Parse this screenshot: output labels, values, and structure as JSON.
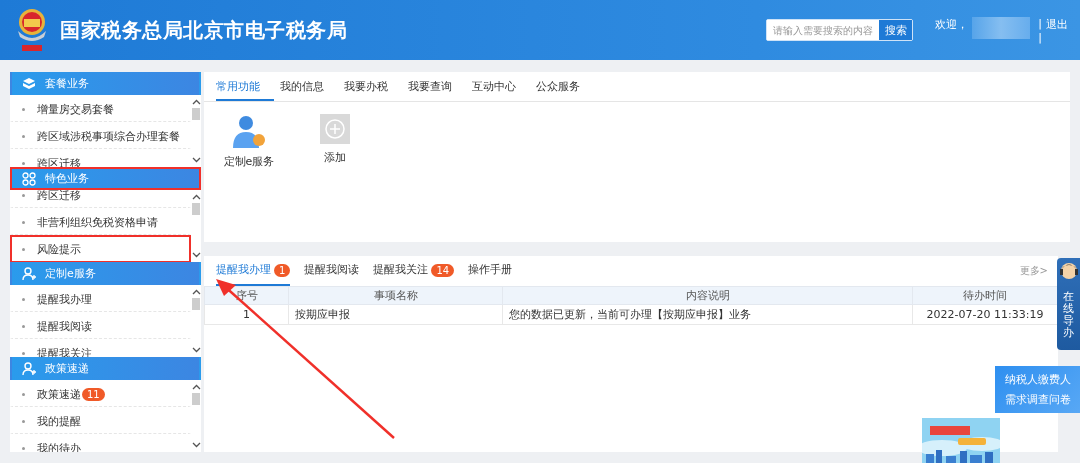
{
  "header": {
    "title": "国家税务总局北京市电子税务局",
    "search": {
      "placeholder": "请输入需要搜索的内容",
      "button": "搜索"
    },
    "welcome": "欢迎，",
    "separator": "|",
    "logout": "退出",
    "separator_2": "|"
  },
  "sidebar": {
    "sections": [
      {
        "title": "套餐业务",
        "highlighted": false,
        "items": [
          {
            "label": "增量房交易套餐",
            "highlighted": false
          },
          {
            "label": "跨区域涉税事项综合办理套餐",
            "highlighted": false
          },
          {
            "label": "跨区迁移",
            "highlighted": false
          }
        ]
      },
      {
        "title": "特色业务",
        "highlighted": true,
        "items": [
          {
            "label": "跨区迁移",
            "highlighted": false
          },
          {
            "label": "非营利组织免税资格申请",
            "highlighted": false
          },
          {
            "label": "风险提示",
            "highlighted": true
          }
        ]
      },
      {
        "title": "定制e服务",
        "highlighted": false,
        "items": [
          {
            "label": "提醒我办理",
            "highlighted": false
          },
          {
            "label": "提醒我阅读",
            "highlighted": false
          },
          {
            "label": "提醒我关注",
            "highlighted": false
          }
        ]
      },
      {
        "title": "政策速递",
        "highlighted": false,
        "items": [
          {
            "label": "政策速递",
            "badge": "11",
            "highlighted": false
          },
          {
            "label": "我的提醒",
            "highlighted": false
          },
          {
            "label": "我的待办",
            "highlighted": false
          }
        ]
      }
    ]
  },
  "functions": {
    "tabs": [
      {
        "label": "常用功能",
        "selected": true
      },
      {
        "label": "我的信息",
        "selected": false
      },
      {
        "label": "我要办税",
        "selected": false
      },
      {
        "label": "我要查询",
        "selected": false
      },
      {
        "label": "互动中心",
        "selected": false
      },
      {
        "label": "公众服务",
        "selected": false
      }
    ],
    "tiles": [
      {
        "kind": "service",
        "label": "定制e服务"
      },
      {
        "kind": "add",
        "label": "添加"
      }
    ]
  },
  "reminders": {
    "tabs": [
      {
        "label": "提醒我办理",
        "badge": "1",
        "selected": true
      },
      {
        "label": "提醒我阅读",
        "selected": false
      },
      {
        "label": "提醒我关注",
        "badge": "14",
        "selected": false
      },
      {
        "label": "操作手册",
        "selected": false
      }
    ],
    "more": "更多>",
    "table": {
      "columns": [
        "序号",
        "事项名称",
        "内容说明",
        "待办时间"
      ],
      "rows": [
        [
          "1",
          "按期应申报",
          "您的数据已更新，当前可办理【按期应申报】业务",
          "2022-07-20 11:33:19"
        ]
      ]
    }
  },
  "online_guide": {
    "label": "在线导办"
  },
  "survey": {
    "lines": [
      "纳税人缴费人",
      "需求调查问卷"
    ]
  },
  "arrow": true
}
